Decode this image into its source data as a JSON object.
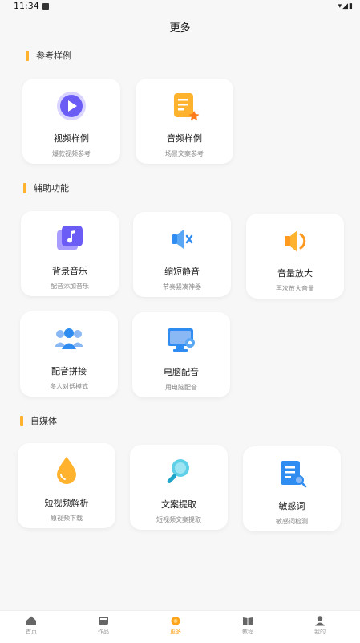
{
  "status": {
    "time": "11:34"
  },
  "page": {
    "title": "更多"
  },
  "sections": [
    {
      "title": "参考样例"
    },
    {
      "title": "辅助功能"
    },
    {
      "title": "自媒体"
    }
  ],
  "cards": [
    {
      "name": "视频样例",
      "desc": "爆款视频参考",
      "icon": "video-play-icon"
    },
    {
      "name": "音频样例",
      "desc": "场景文案参考",
      "icon": "audio-document-icon"
    },
    {
      "name": "背景音乐",
      "desc": "配音添加音乐",
      "icon": "music-icon"
    },
    {
      "name": "缩短静音",
      "desc": "节奏紧凑神器",
      "icon": "mute-speaker-icon"
    },
    {
      "name": "音量放大",
      "desc": "再次放大音量",
      "icon": "volume-icon"
    },
    {
      "name": "配音拼接",
      "desc": "多人对话模式",
      "icon": "people-icon"
    },
    {
      "name": "电脑配音",
      "desc": "用电脑配音",
      "icon": "computer-icon"
    },
    {
      "name": "短视频解析",
      "desc": "原视频下载",
      "icon": "drop-icon"
    },
    {
      "name": "文案提取",
      "desc": "短视频文案提取",
      "icon": "magnifier-icon"
    },
    {
      "name": "敏感词",
      "desc": "敏感词检测",
      "icon": "document-search-icon"
    }
  ],
  "tabs": [
    {
      "label": "首页",
      "icon": "home-icon"
    },
    {
      "label": "作品",
      "icon": "works-icon"
    },
    {
      "label": "更多",
      "icon": "more-icon",
      "active": true
    },
    {
      "label": "教程",
      "icon": "book-icon"
    },
    {
      "label": "我的",
      "icon": "profile-icon"
    }
  ],
  "colors": {
    "accent": "#ffb22e",
    "purple": "#6b5cf5",
    "blue": "#2f8cf0",
    "orange": "#ff9a1f",
    "active_tab": "#ffa41b"
  }
}
